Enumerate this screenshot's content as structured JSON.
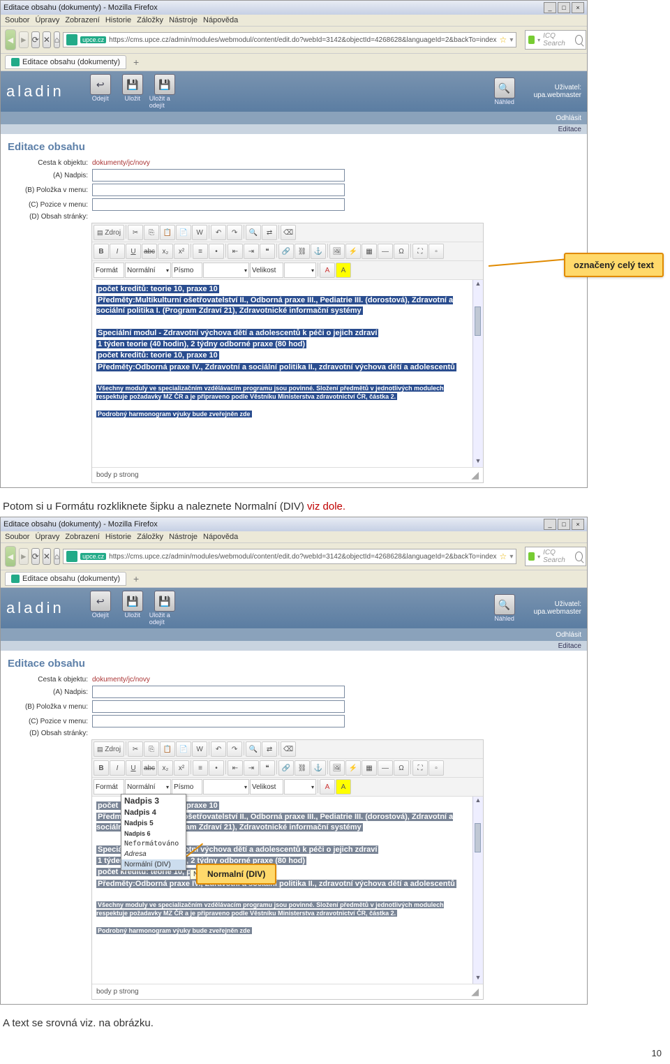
{
  "screenshot1": {
    "window_title": "Editace obsahu (dokumenty) - Mozilla Firefox",
    "menu": [
      "Soubor",
      "Úpravy",
      "Zobrazení",
      "Historie",
      "Záložky",
      "Nástroje",
      "Nápověda"
    ],
    "url": "https://cms.upce.cz/admin/modules/webmodul/content/edit.do?webId=3142&objectId=4268628&languageId=2&backTo=index",
    "search_placeholder": "ICQ Search",
    "tab_label": "Editace obsahu (dokumenty)",
    "logo": "aladin",
    "toolbar": [
      {
        "label": "Odejít"
      },
      {
        "label": "Uložit"
      },
      {
        "label": "Uložit a odejít"
      },
      {
        "label": "Náhled"
      }
    ],
    "user": {
      "caption": "Uživatel:",
      "name": "upa.webmaster"
    },
    "logout": "Odhlásit",
    "breadcrumb": "Editace",
    "page_title": "Editace obsahu",
    "fields": {
      "path_label": "Cesta k objektu:",
      "path_value": "dokumenty/jc/novy",
      "a": "(A) Nadpis:",
      "b": "(B) Položka v menu:",
      "c": "(C) Pozice v menu:",
      "d": "(D) Obsah stránky:"
    },
    "editor_toolbar_row1": [
      "Zdroj"
    ],
    "format_labels": {
      "format": "Formát",
      "format_val": "Normální",
      "font": "Písmo",
      "size": "Velikost"
    },
    "editor_content": [
      "počet kreditů: teorie 10, praxe 10",
      "Předměty:Multikulturní ošetřovatelství II., Odborná praxe III., Pediatrie III. (dorostová), Zdravotní a sociální politika I. (Program Zdraví 21), Zdravotnické informační systémy",
      "Speciální modul - Zdravotní výchova dětí a adolescentů k péči o jejich zdraví",
      "1 týden teorie (40 hodin), 2 týdny odborné praxe (80 hod)",
      "počet kreditů: teorie 10, praxe 10",
      "Předměty:Odborná praxe IV., Zdravotní a sociální politika II., zdravotní výchova dětí a adolescentů",
      "Všechny moduly ve specializačním vzdělávacím programu jsou povinné. Složení předmětů v jednotlivých modulech respektuje požadavky MZ ČR a je připraveno podle Věstníku Ministerstva zdravotnictví ČR, částka 2.",
      "Podrobný harmonogram výuky bude zveřejněn zde"
    ],
    "editor_status": "body  p  strong"
  },
  "callout1": "označený celý text",
  "doc_text1_a": "Potom si u Formátu rozkliknete šipku a naleznete  Normalní (DIV) ",
  "doc_text1_b": "viz dole.",
  "screenshot2": {
    "format_options": [
      "Nadpis 3",
      "Nadpis 4",
      "Nadpis 5",
      "Nadpis 6",
      "Neformátováno",
      "Adresa",
      "Normální (DIV)"
    ],
    "dd_tip": "Normální (DIV)"
  },
  "callout2": "Normalní (DIV)",
  "doc_text2": "A text se srovná viz. na obrázku.",
  "page_number": "10"
}
